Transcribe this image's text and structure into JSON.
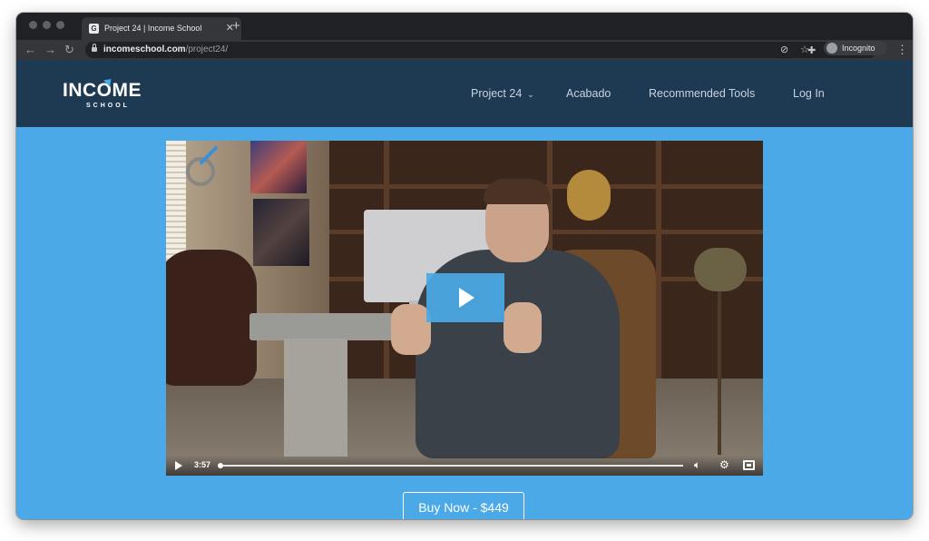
{
  "browser": {
    "tab": {
      "title": "Project 24 | Income School",
      "favicon": "G"
    },
    "new_tab_icon": "plus-icon",
    "address": {
      "domain": "incomeschool.com",
      "path": "/project24/"
    },
    "profile_label": "Incognito"
  },
  "site": {
    "logo": {
      "main": "INCOME",
      "sub": "SCHOOL"
    },
    "nav": [
      {
        "label": "Project 24",
        "has_dropdown": true
      },
      {
        "label": "Acabado"
      },
      {
        "label": "Recommended Tools"
      },
      {
        "label": "Log In"
      }
    ]
  },
  "video": {
    "duration": "3:57",
    "progress_fraction": 0.0,
    "play_icon": "play-icon"
  },
  "cta": {
    "label": "Buy Now - $449"
  },
  "colors": {
    "page_bg": "#4aa9e6",
    "header_bg": "#1e3a52",
    "nav_text": "#c8d3dd",
    "play_button": "#4aa9e6"
  }
}
